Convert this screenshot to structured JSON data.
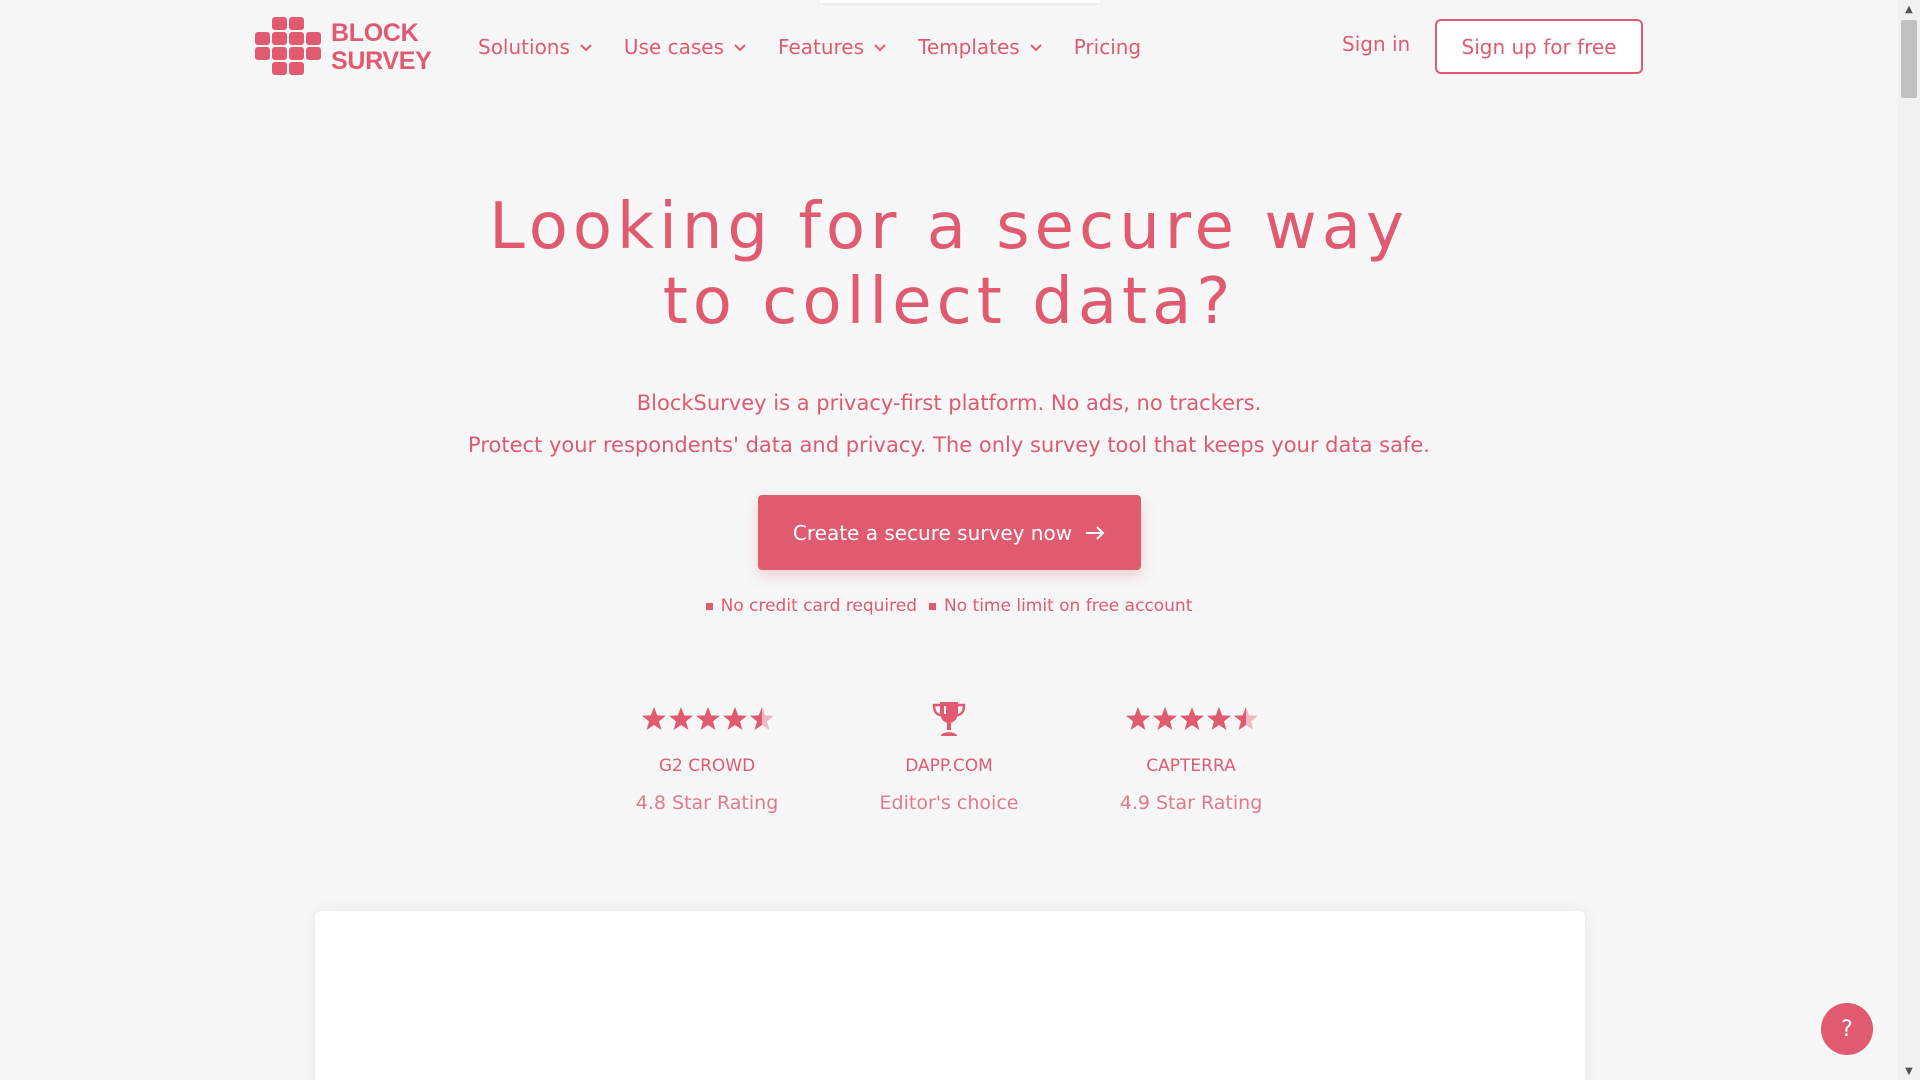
{
  "brand": {
    "line1": "BLOCK",
    "line2": "SURVEY",
    "color": "#e05a70"
  },
  "nav": {
    "items": [
      {
        "label": "Solutions",
        "has_dropdown": true
      },
      {
        "label": "Use cases",
        "has_dropdown": true
      },
      {
        "label": "Features",
        "has_dropdown": true
      },
      {
        "label": "Templates",
        "has_dropdown": true
      },
      {
        "label": "Pricing",
        "has_dropdown": false
      }
    ],
    "signin": "Sign in",
    "signup": "Sign up for free"
  },
  "hero": {
    "title_line1": "Looking for a secure way",
    "title_line2": "to collect data?",
    "subtitle_line1": "BlockSurvey is a privacy-first platform. No ads, no trackers.",
    "subtitle_line2": "Protect your respondents' data and privacy. The only survey tool that keeps your data safe.",
    "cta": "Create a secure survey now",
    "checks": [
      "No credit card required",
      "No time limit on free account"
    ]
  },
  "ratings": [
    {
      "icon": "star-rating-icon",
      "stars": 4.5,
      "name": "G2 CROWD",
      "desc": "4.8 Star Rating"
    },
    {
      "icon": "trophy-icon",
      "name": "DAPP.COM",
      "desc": "Editor's choice"
    },
    {
      "icon": "star-rating-icon",
      "stars": 4.5,
      "name": "CAPTERRA",
      "desc": "4.9 Star Rating"
    }
  ],
  "help": {
    "label": "?"
  }
}
